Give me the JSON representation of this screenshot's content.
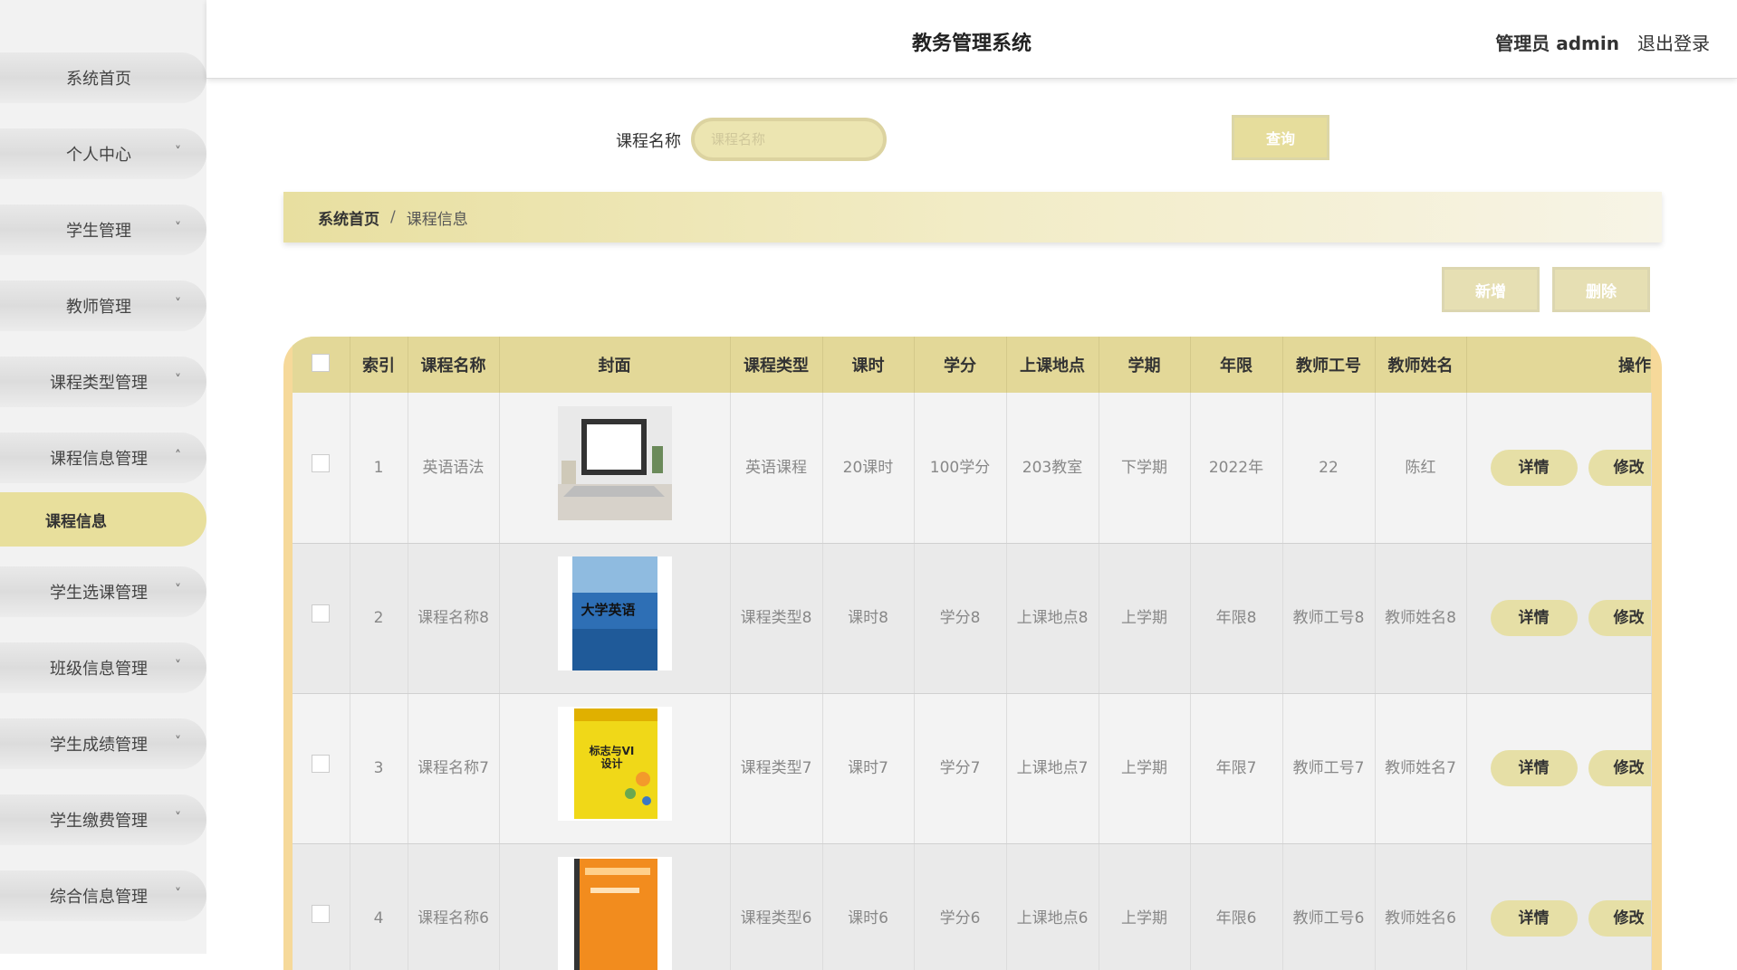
{
  "header": {
    "title": "教务管理系统",
    "admin_label": "管理员 admin",
    "logout_label": "退出登录"
  },
  "sidebar": {
    "items": [
      {
        "label": "系统首页"
      },
      {
        "label": "个人中心"
      },
      {
        "label": "学生管理"
      },
      {
        "label": "教师管理"
      },
      {
        "label": "课程类型管理"
      },
      {
        "label": "课程信息管理"
      },
      {
        "label": "课程信息"
      },
      {
        "label": "学生选课管理"
      },
      {
        "label": "班级信息管理"
      },
      {
        "label": "学生成绩管理"
      },
      {
        "label": "学生缴费管理"
      },
      {
        "label": "综合信息管理"
      }
    ],
    "chevron_down": "˅",
    "chevron_up": "˄"
  },
  "search": {
    "label": "课程名称",
    "placeholder": "课程名称",
    "button": "查询"
  },
  "breadcrumb": {
    "home": "系统首页",
    "separator": "/",
    "current": "课程信息"
  },
  "actions": {
    "add": "新增",
    "delete": "删除"
  },
  "table": {
    "columns": [
      "索引",
      "课程名称",
      "封面",
      "课程类型",
      "课时",
      "学分",
      "上课地点",
      "学期",
      "年限",
      "教师工号",
      "教师姓名",
      "操作"
    ],
    "rows": [
      {
        "index": "1",
        "name": "英语语法",
        "type": "英语课程",
        "hours": "20课时",
        "credit": "100学分",
        "place": "203教室",
        "term": "下学期",
        "year": "2022年",
        "teacher_id": "22",
        "teacher_name": "陈红"
      },
      {
        "index": "2",
        "name": "课程名称8",
        "type": "课程类型8",
        "hours": "课时8",
        "credit": "学分8",
        "place": "上课地点8",
        "term": "上学期",
        "year": "年限8",
        "teacher_id": "教师工号8",
        "teacher_name": "教师姓名8"
      },
      {
        "index": "3",
        "name": "课程名称7",
        "type": "课程类型7",
        "hours": "课时7",
        "credit": "学分7",
        "place": "上课地点7",
        "term": "上学期",
        "year": "年限7",
        "teacher_id": "教师工号7",
        "teacher_name": "教师姓名7"
      },
      {
        "index": "4",
        "name": "课程名称6",
        "type": "课程类型6",
        "hours": "课时6",
        "credit": "学分6",
        "place": "上课地点6",
        "term": "上学期",
        "year": "年限6",
        "teacher_id": "教师工号6",
        "teacher_name": "教师姓名6"
      }
    ],
    "detail_label": "详情",
    "edit_label": "修改"
  },
  "covers": [
    {
      "icon": "laptop-cover"
    },
    {
      "icon": "book-cover-college-english",
      "text": "大学英语"
    },
    {
      "icon": "book-cover-logo-vi-design",
      "text": "标志与VI设计"
    },
    {
      "icon": "book-cover-orange-book"
    }
  ]
}
